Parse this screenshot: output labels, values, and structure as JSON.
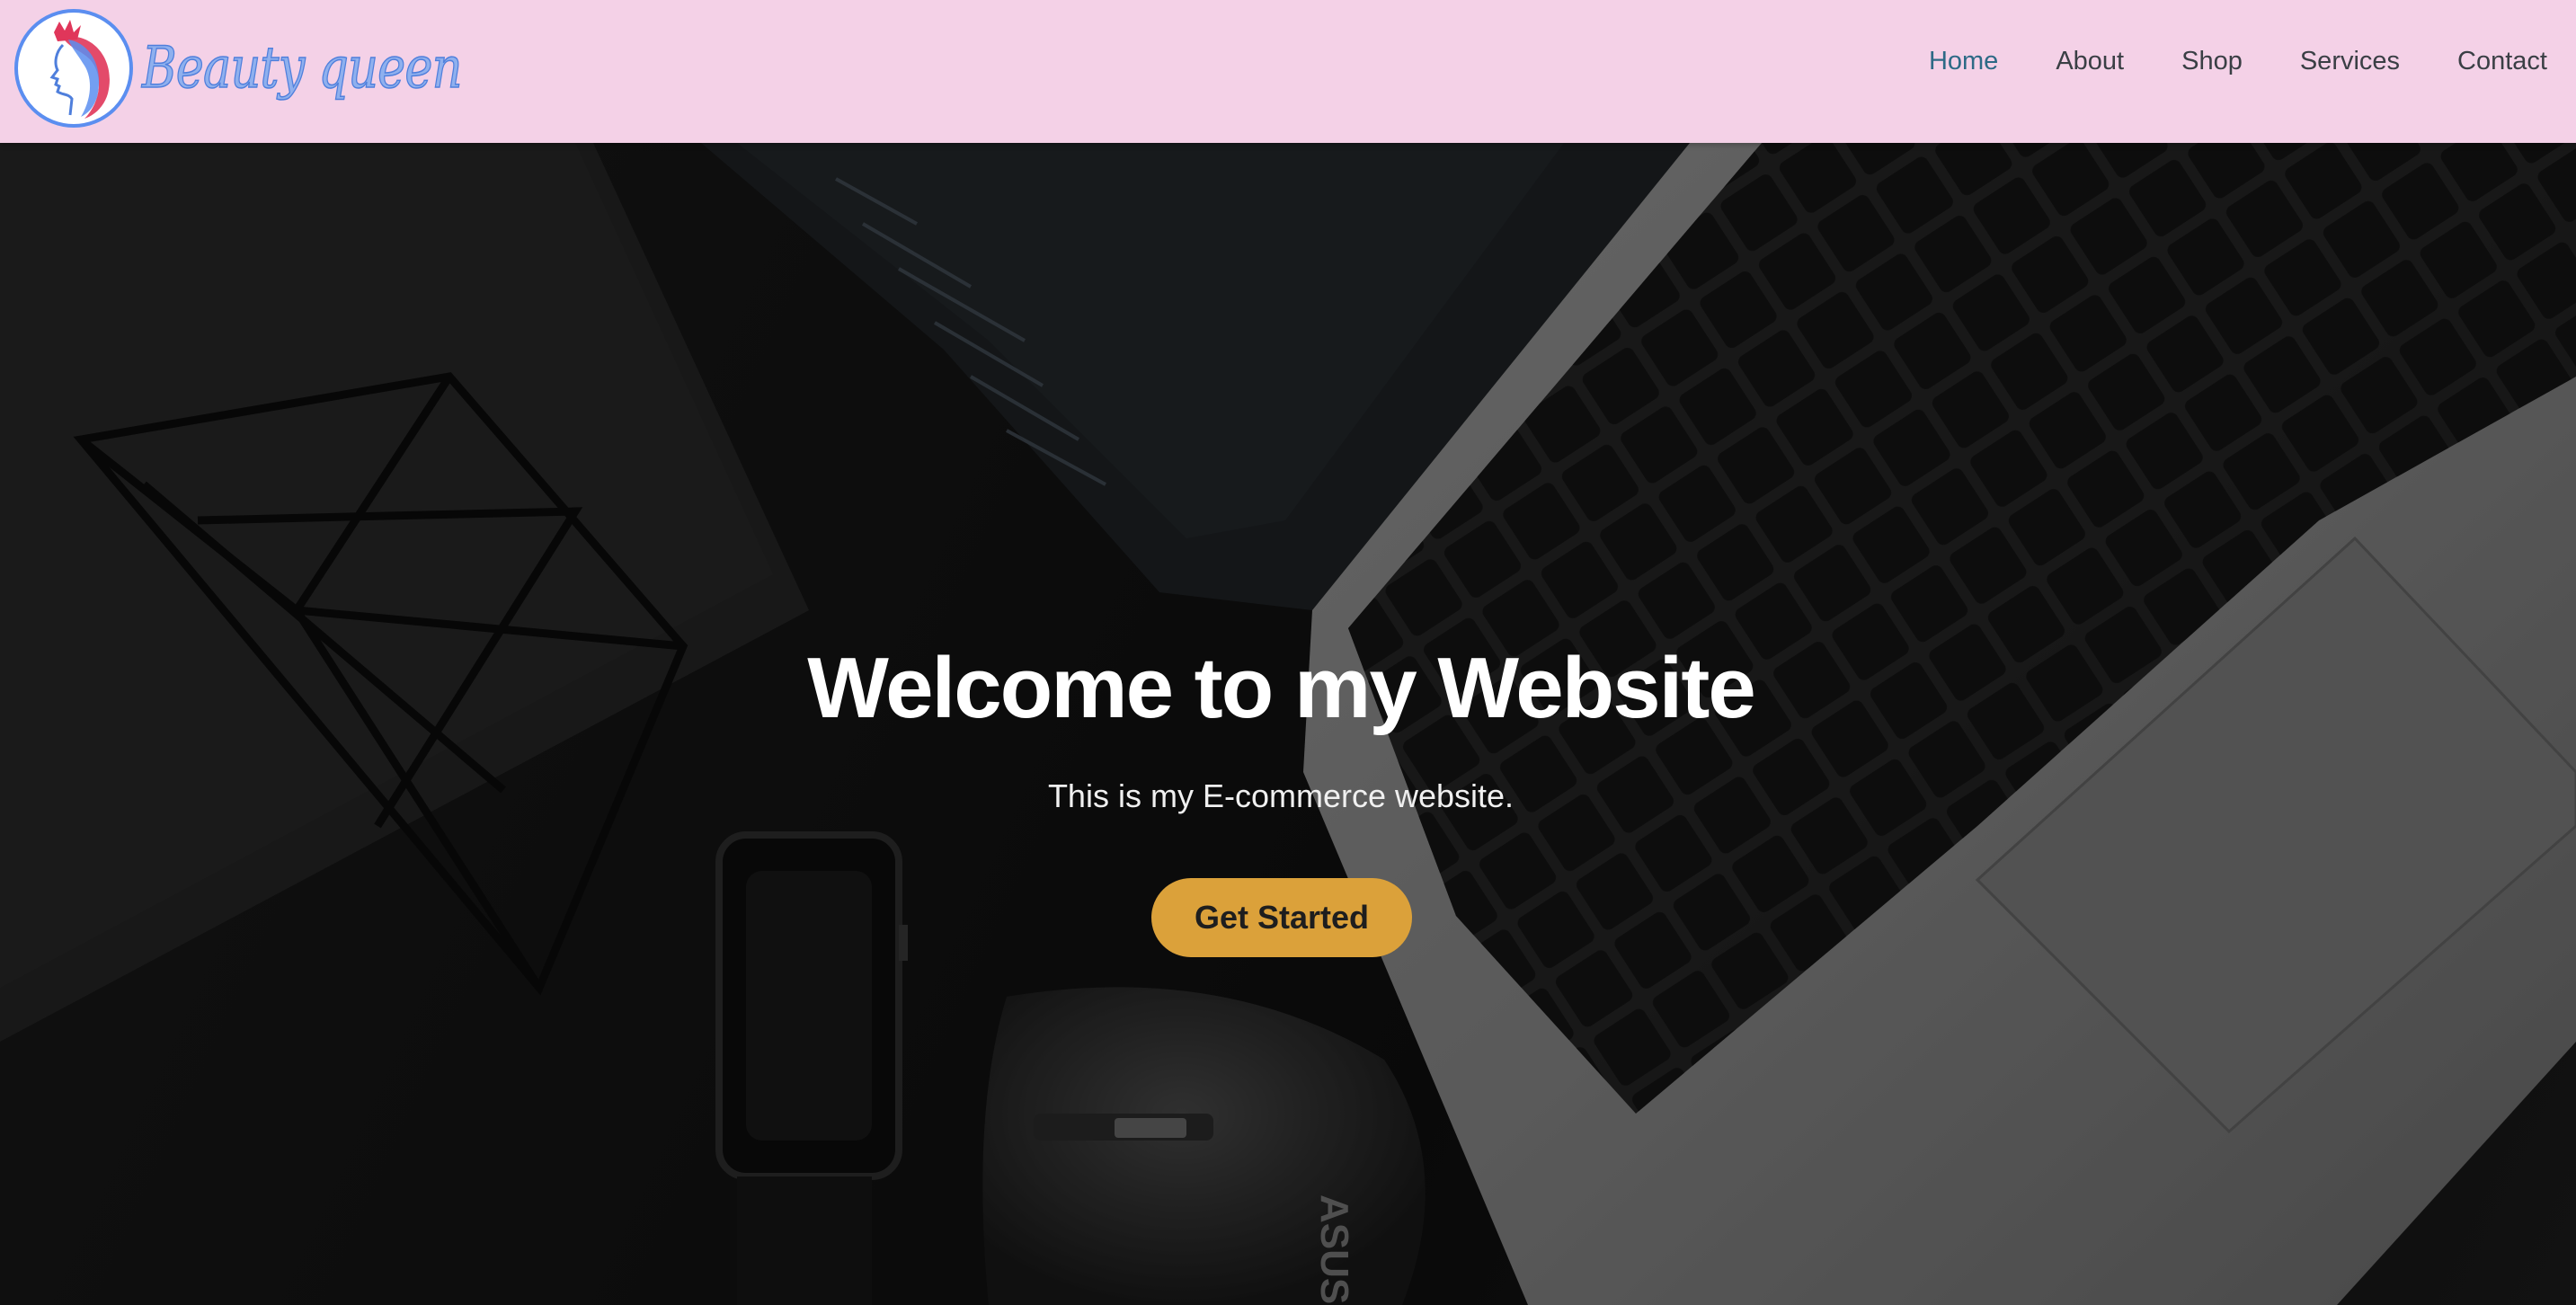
{
  "header": {
    "logo_text": "Beauty queen",
    "logo_icon": "queen-silhouette-icon"
  },
  "nav": {
    "items": [
      {
        "label": "Home",
        "active": true
      },
      {
        "label": "About"
      },
      {
        "label": "Shop"
      },
      {
        "label": "Services"
      },
      {
        "label": "Contact"
      }
    ]
  },
  "hero": {
    "title": "Welcome to my Website",
    "subtitle": "This is my E-commerce website.",
    "cta_label": "Get Started"
  },
  "colors": {
    "header_bg": "#f4d1e7",
    "nav_active": "#2d6a86",
    "nav_text": "#3a3f45",
    "cta_bg": "#dba13a",
    "logo_blue": "#5b8ef0",
    "logo_accent": "#e0365a"
  },
  "background_image": {
    "description_icon": "laptop-desk-photo",
    "laptop_brand_on_mouse": "ASUS"
  }
}
